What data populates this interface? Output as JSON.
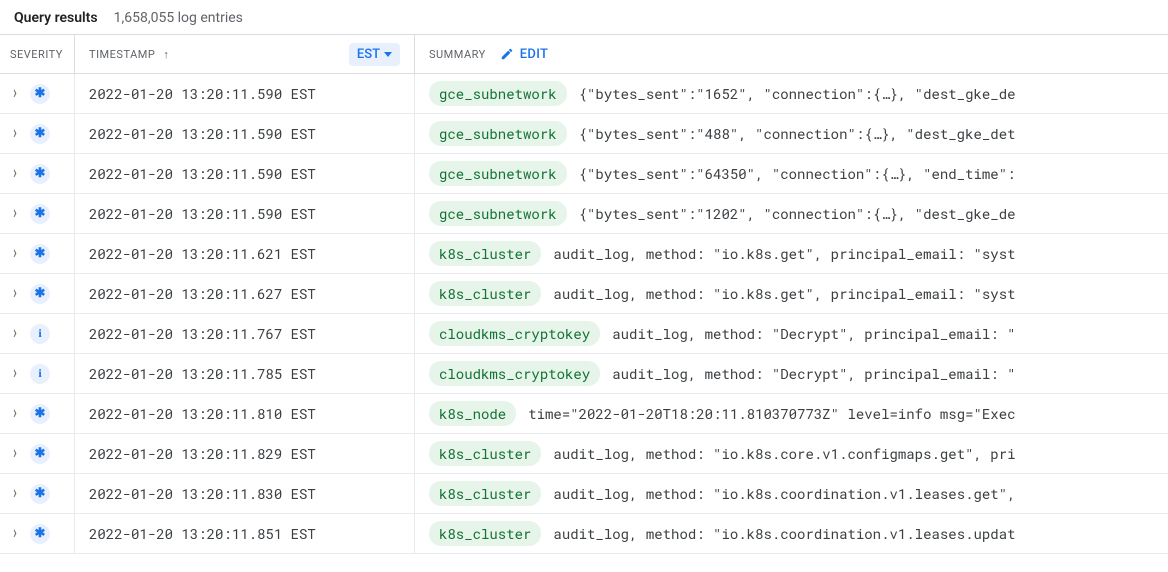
{
  "header": {
    "title": "Query results",
    "count_text": "1,658,055 log entries"
  },
  "columns": {
    "severity_label": "SEVERITY",
    "timestamp_label": "TIMESTAMP",
    "summary_label": "SUMMARY",
    "timezone": "EST",
    "edit_label": "EDIT"
  },
  "rows": [
    {
      "severity": "default",
      "timestamp": "2022-01-20 13:20:11.590 EST",
      "resource": "gce_subnetwork",
      "summary": "{\"bytes_sent\":\"1652\", \"connection\":{…}, \"dest_gke_de"
    },
    {
      "severity": "default",
      "timestamp": "2022-01-20 13:20:11.590 EST",
      "resource": "gce_subnetwork",
      "summary": "{\"bytes_sent\":\"488\", \"connection\":{…}, \"dest_gke_det"
    },
    {
      "severity": "default",
      "timestamp": "2022-01-20 13:20:11.590 EST",
      "resource": "gce_subnetwork",
      "summary": "{\"bytes_sent\":\"64350\", \"connection\":{…}, \"end_time\":"
    },
    {
      "severity": "default",
      "timestamp": "2022-01-20 13:20:11.590 EST",
      "resource": "gce_subnetwork",
      "summary": "{\"bytes_sent\":\"1202\", \"connection\":{…}, \"dest_gke_de"
    },
    {
      "severity": "default",
      "timestamp": "2022-01-20 13:20:11.621 EST",
      "resource": "k8s_cluster",
      "summary": "audit_log, method: \"io.k8s.get\", principal_email: \"syst"
    },
    {
      "severity": "default",
      "timestamp": "2022-01-20 13:20:11.627 EST",
      "resource": "k8s_cluster",
      "summary": "audit_log, method: \"io.k8s.get\", principal_email: \"syst"
    },
    {
      "severity": "info",
      "timestamp": "2022-01-20 13:20:11.767 EST",
      "resource": "cloudkms_cryptokey",
      "summary": "audit_log, method: \"Decrypt\", principal_email: \""
    },
    {
      "severity": "info",
      "timestamp": "2022-01-20 13:20:11.785 EST",
      "resource": "cloudkms_cryptokey",
      "summary": "audit_log, method: \"Decrypt\", principal_email: \""
    },
    {
      "severity": "default",
      "timestamp": "2022-01-20 13:20:11.810 EST",
      "resource": "k8s_node",
      "summary": "time=\"2022-01-20T18:20:11.810370773Z\" level=info msg=\"Exec"
    },
    {
      "severity": "default",
      "timestamp": "2022-01-20 13:20:11.829 EST",
      "resource": "k8s_cluster",
      "summary": "audit_log, method: \"io.k8s.core.v1.configmaps.get\", pri"
    },
    {
      "severity": "default",
      "timestamp": "2022-01-20 13:20:11.830 EST",
      "resource": "k8s_cluster",
      "summary": "audit_log, method: \"io.k8s.coordination.v1.leases.get\","
    },
    {
      "severity": "default",
      "timestamp": "2022-01-20 13:20:11.851 EST",
      "resource": "k8s_cluster",
      "summary": "audit_log, method: \"io.k8s.coordination.v1.leases.updat"
    }
  ]
}
